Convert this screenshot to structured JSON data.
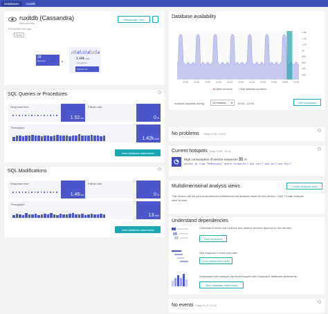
{
  "breadcrumb": [
    "Databases",
    "ruxitdb"
  ],
  "service": {
    "name": "ruxitdb (Cassandra)",
    "seen": "Seen recently",
    "props_label": "Properties and tags",
    "tag": "CLOJ",
    "smartscape_label": "Smartscape view",
    "more_label": "...",
    "flow": {
      "left_count": "28",
      "left_label": "Services",
      "right_value": "1.44k",
      "right_unit": "/min",
      "right_label": "Throughput",
      "target_label": "Apache Ca..."
    }
  },
  "sql_queries": {
    "title": "SQL Queries or Procedures",
    "response_time_label": "Response time",
    "response_time_value": "1.52",
    "response_time_unit": "ms",
    "failure_rate_label": "Failure rate",
    "failure_rate_value": "0",
    "failure_rate_unit": "%",
    "throughput_label": "Throughput",
    "throughput_value": "1.42k",
    "throughput_unit": "/min",
    "throughput_bars": [
      0.45,
      0.55,
      0.6,
      0.5,
      0.55,
      0.6,
      0.65,
      0.55,
      0.6,
      0.5,
      0.6,
      0.55,
      0.5,
      0.6,
      0.65,
      0.6,
      0.55,
      0.6,
      0.5,
      0.55,
      0.6,
      0.7,
      0.6,
      0.55,
      0.6,
      0.65,
      0.55,
      0.6,
      0.5,
      0.55
    ],
    "button": "View database statements"
  },
  "sql_mods": {
    "title": "SQL Modifications",
    "response_time_label": "Response time",
    "response_time_value": "1.49",
    "response_time_unit": "ms",
    "failure_rate_label": "Failure rate",
    "failure_rate_value": "0",
    "failure_rate_unit": "%",
    "throughput_label": "Throughput",
    "throughput_value": "13",
    "throughput_unit": "/min",
    "throughput_bars": [
      0.35,
      0.5,
      0.45,
      0.3,
      0.55,
      0.4,
      0.45,
      0.5,
      0.35,
      0.45,
      0.5,
      0.4,
      0.55,
      0.45,
      0.35,
      0.5,
      0.45,
      0.4,
      0.5,
      0.55,
      0.45,
      0.4,
      0.5,
      0.35,
      0.45,
      0.5,
      0.4,
      0.45,
      0.5,
      0.45
    ],
    "button": "View database statements"
  },
  "availability": {
    "title": "Database availability",
    "y_ticks": [
      "1.6k",
      "1.4k",
      "1.2k",
      "1k",
      "800",
      "600",
      "400",
      "200"
    ],
    "x_ticks": [
      "11:30",
      "11:40",
      "11:50",
      "12:00",
      "12:10",
      "12:20",
      "12:30",
      "12:40",
      "12:50",
      "13:00",
      "13:10"
    ],
    "legend_failed": "Failed connects",
    "legend_total": "Total database accesses",
    "analyze_label": "Analyze requests during",
    "analyze_select": "10 minutes",
    "range": "13:08 - 13:18",
    "backtrace_btn": "View backtrace",
    "colors": {
      "area": "#c5c9ef",
      "peak": "#9aa2e5",
      "highlight": "#2ea6b0",
      "failed": "#e03e3e"
    }
  },
  "no_problems": {
    "title": "No problems",
    "time": "Today 11:18 - 13:18"
  },
  "hotspots": {
    "title": "Current hotspots",
    "time": "Today 13:08 - 13:18",
    "headline_pre": "High consumption of service resources",
    "headline_pct": "31",
    "headline_unit": "%",
    "query": "select id from \"MeMinutes\" where tenantId=? and id>=? and id<? and key=?"
  },
  "multidim": {
    "title": "Multidimensional analysis views",
    "button": "Create analysis view",
    "desc": "This section will list your bookmarked multidimensional analysis views for this service. Click 'Create analysis view' to start."
  },
  "deps": {
    "title": "Understand dependencies",
    "items": [
      {
        "text": "Understand which user actions and related services depend on this service.",
        "button": "View backtrace"
      },
      {
        "text": "See requests in trace overview.",
        "button": "View distributed traces"
      },
      {
        "text": "Understand and analyze the most frequent and expensive database statements.",
        "button": "View database statements"
      }
    ]
  },
  "no_events": {
    "title": "No events",
    "time": "Today 11:18 - 13:18"
  }
}
